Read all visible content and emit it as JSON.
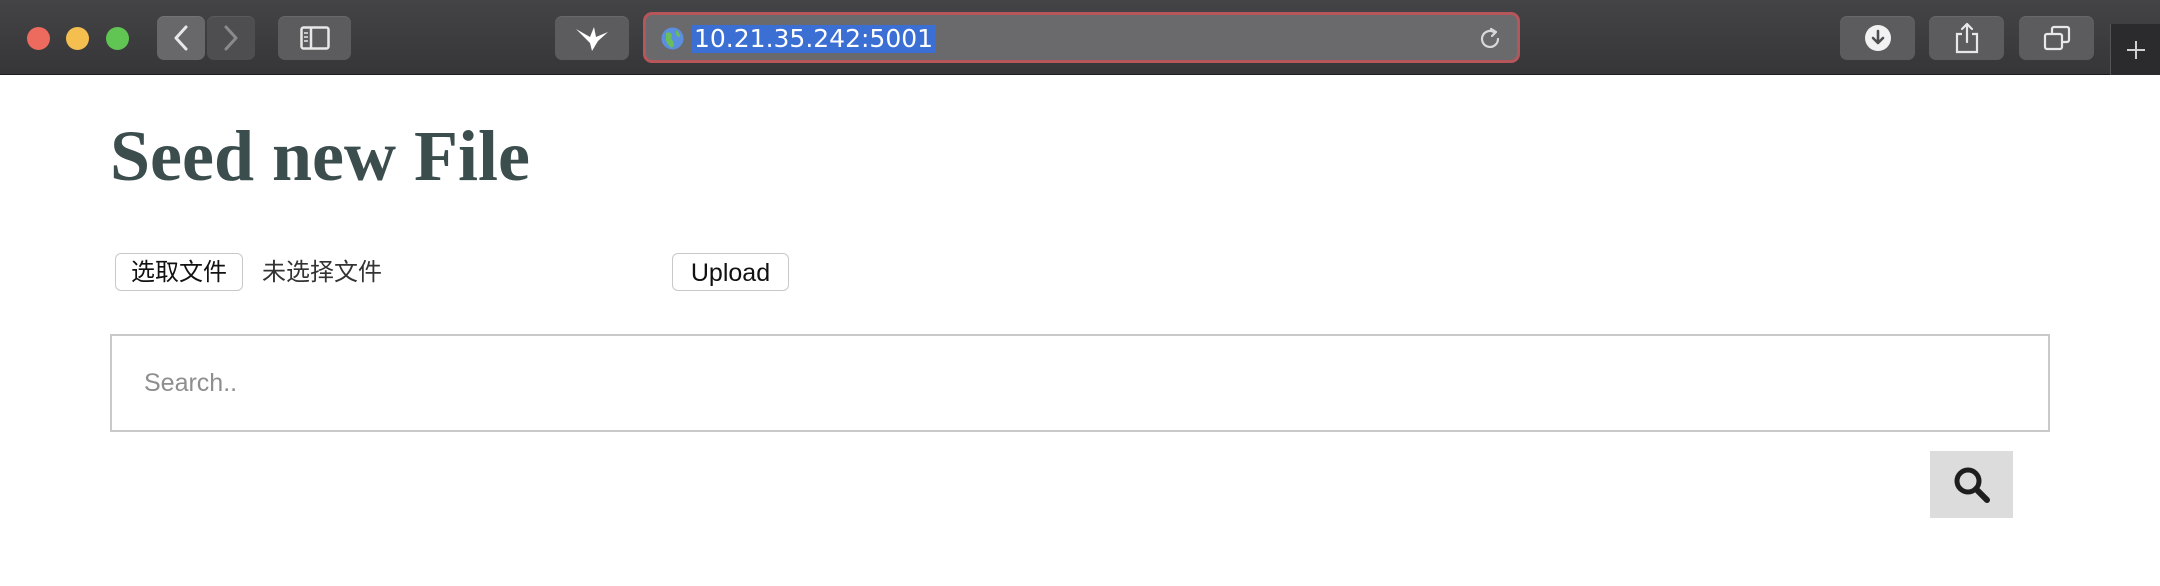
{
  "browser": {
    "url": "10.21.35.242:5001",
    "icons": {
      "back": "chevron-left-icon",
      "forward": "chevron-right-icon",
      "sidebar": "sidebar-icon",
      "extension": "bird-icon",
      "site": "globe-icon",
      "reload": "reload-icon",
      "download": "download-icon",
      "share": "share-icon",
      "tabs": "tabs-icon",
      "new_tab": "plus-icon"
    },
    "colors": {
      "url_highlight": "#3b6fd4",
      "url_focus_ring": "#b5565a"
    }
  },
  "page": {
    "title": "Seed new File",
    "file_input": {
      "button_label": "选取文件",
      "status": "未选择文件"
    },
    "upload_label": "Upload",
    "search": {
      "placeholder": "Search..",
      "value": ""
    },
    "search_button_icon": "search-icon",
    "colors": {
      "title": "#3c4d4e",
      "search_button_bg": "#dcdcdc"
    }
  }
}
